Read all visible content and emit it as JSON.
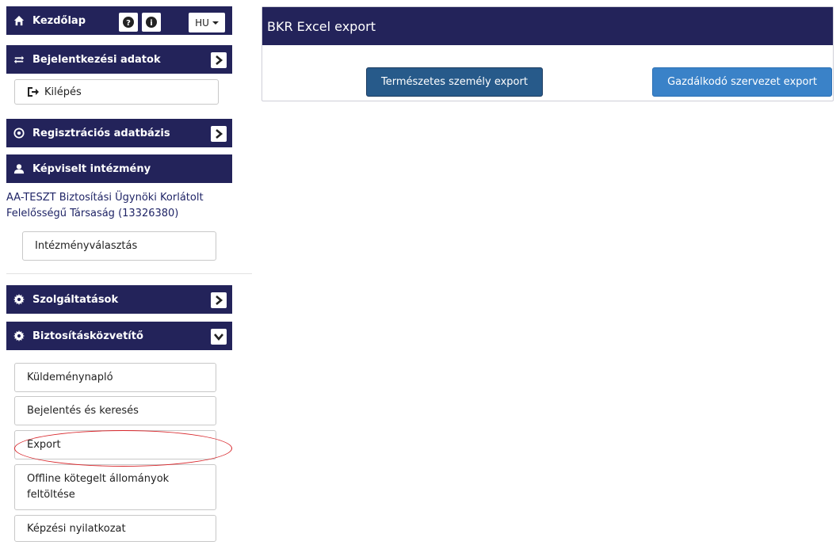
{
  "colors": {
    "navy": "#23235a",
    "button_dark": "#275a8a",
    "button_light": "#3a82c8",
    "highlight": "#d8262b",
    "link_text": "#1f2466"
  },
  "sidebar": {
    "home": {
      "label": "Kezdőlap",
      "icon": "home-icon",
      "help_icon": "question-circle-icon",
      "info_icon": "info-circle-icon",
      "language": "HU"
    },
    "login_data": {
      "label": "Bejelentkezési adatok",
      "icon": "exchange-icon"
    },
    "logout": {
      "label": "Kilépés",
      "icon": "logout-icon"
    },
    "registration_db": {
      "label": "Regisztrációs adatbázis",
      "icon": "dot-circle-icon"
    },
    "represented": {
      "label": "Képviselt intézmény",
      "icon": "user-icon",
      "org_line1": "AA-TESZT Biztosítási Ügynöki Korlátolt",
      "org_line2": "Felelősségű Társaság (13326380)",
      "select_label": "Intézményválasztás"
    },
    "services": {
      "label": "Szolgáltatások",
      "icon": "gear-icon"
    },
    "broker": {
      "label": "Biztosításközvetítő",
      "icon": "gear-icon",
      "items": [
        {
          "label": "Küldeménynapló"
        },
        {
          "label": "Bejelentés és keresés"
        },
        {
          "label": "Export"
        },
        {
          "label1": "Offline kötegelt állományok",
          "label2": "feltöltése"
        },
        {
          "label": "Képzési nyilatkozat"
        }
      ]
    }
  },
  "main": {
    "title": "BKR Excel export",
    "buttons": {
      "natural_person": "Természetes személy export",
      "business_org": "Gazdálkodó szervezet export"
    }
  }
}
